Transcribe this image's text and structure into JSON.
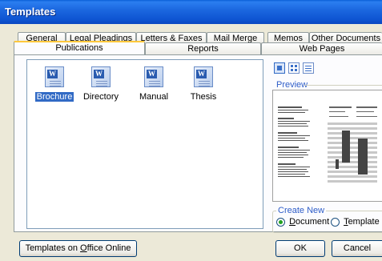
{
  "window": {
    "title": "Templates"
  },
  "tabs_back": [
    "General",
    "Legal Pleadings",
    "Letters & Faxes",
    "Mail Merge",
    "Memos",
    "Other Documents"
  ],
  "tabs_front": [
    "Publications",
    "Reports",
    "Web Pages"
  ],
  "selected_tab": "Publications",
  "items": [
    {
      "label": "Brochure",
      "icon": "word-document-icon",
      "selected": true
    },
    {
      "label": "Directory",
      "icon": "word-document-icon",
      "selected": false
    },
    {
      "label": "Manual",
      "icon": "word-document-icon",
      "selected": false
    },
    {
      "label": "Thesis",
      "icon": "word-document-icon",
      "selected": false
    }
  ],
  "preview": {
    "label": "Preview"
  },
  "create_new": {
    "label": "Create New",
    "document_pre": "",
    "document_key": "D",
    "document_post": "ocument",
    "template_pre": "",
    "template_key": "T",
    "template_post": "emplate",
    "selected": "Document"
  },
  "buttons": {
    "online_pre": "Templates on ",
    "online_key": "O",
    "online_post": "ffice Online",
    "ok": "OK",
    "cancel": "Cancel"
  },
  "colors": {
    "accent": "#316ac5",
    "titlebar": "#0a5fd8",
    "group_label": "#2e5dc8"
  }
}
